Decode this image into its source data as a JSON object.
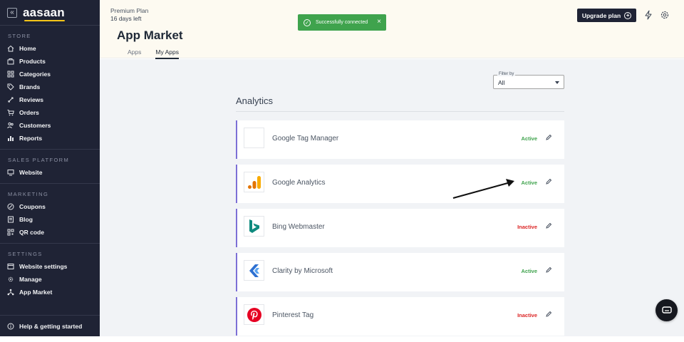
{
  "app": {
    "logo_text": "aasaan",
    "collapse_glyph": "«"
  },
  "sidebar": {
    "sections": [
      {
        "heading": "STORE",
        "items": [
          {
            "label": "Home",
            "icon": "home-icon"
          },
          {
            "label": "Products",
            "icon": "products-icon"
          },
          {
            "label": "Categories",
            "icon": "categories-icon"
          },
          {
            "label": "Brands",
            "icon": "tag-icon"
          },
          {
            "label": "Reviews",
            "icon": "reviews-icon"
          },
          {
            "label": "Orders",
            "icon": "cart-icon"
          },
          {
            "label": "Customers",
            "icon": "users-icon"
          },
          {
            "label": "Reports",
            "icon": "bar-chart-icon"
          }
        ]
      },
      {
        "heading": "SALES PLATFORM",
        "items": [
          {
            "label": "Website",
            "icon": "monitor-icon"
          }
        ]
      },
      {
        "heading": "MARKETING",
        "items": [
          {
            "label": "Coupons",
            "icon": "coupon-icon"
          },
          {
            "label": "Blog",
            "icon": "blog-icon"
          },
          {
            "label": "QR code",
            "icon": "qr-code-icon"
          }
        ]
      },
      {
        "heading": "SETTINGS",
        "items": [
          {
            "label": "Website settings",
            "icon": "website-settings-icon"
          },
          {
            "label": "Manage",
            "icon": "gear-icon"
          },
          {
            "label": "App Market",
            "icon": "app-market-icon"
          }
        ]
      }
    ],
    "help_label": "Help & getting started"
  },
  "header": {
    "plan_name": "Premium Plan",
    "plan_days": "16 days left",
    "title": "App Market",
    "tabs": [
      {
        "label": "Apps",
        "active": false
      },
      {
        "label": "My Apps",
        "active": true
      }
    ],
    "upgrade_label": "Upgrade plan",
    "upgrade_glyph": "+"
  },
  "toast": {
    "message": "Successfully connected",
    "close_glyph": "×",
    "check_glyph": "✓",
    "color": "#3fa34d"
  },
  "filter": {
    "label": "Filter by",
    "value": "All"
  },
  "section": {
    "title": "Analytics"
  },
  "apps": [
    {
      "name": "Google Tag Manager",
      "status": "Active",
      "logo": "blank-logo"
    },
    {
      "name": "Google Analytics",
      "status": "Active",
      "logo": "google-analytics-logo"
    },
    {
      "name": "Bing Webmaster",
      "status": "Inactive",
      "logo": "bing-logo"
    },
    {
      "name": "Clarity by Microsoft",
      "status": "Active",
      "logo": "clarity-logo"
    },
    {
      "name": "Pinterest Tag",
      "status": "Inactive",
      "logo": "pinterest-logo"
    }
  ],
  "colors": {
    "sidebar_bg": "#1f2335",
    "active": "#3fa34d",
    "inactive": "#dc2626",
    "card_accent": "#7c6fd6",
    "header_bg": "#fdfaf1"
  }
}
